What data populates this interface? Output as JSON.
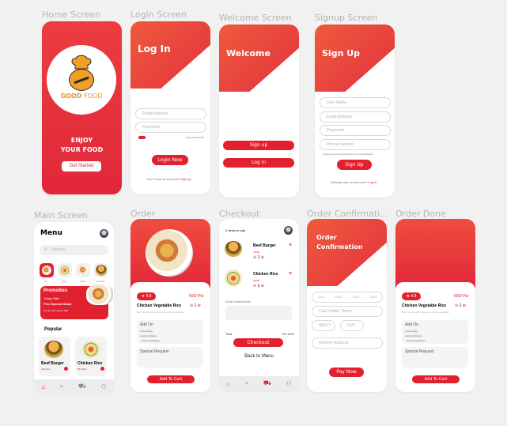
{
  "frame_titles": {
    "home": "Home Screen",
    "login": "Login Screen",
    "welcome": "Welcome Screen",
    "signup": "Signup Screen",
    "main": "Main Screen",
    "order": "Order",
    "checkout": "Checkout",
    "confirmation": "Order Confirmati...",
    "done": "Order Done"
  },
  "colors": {
    "accent": "#e2212f",
    "gradient_start": "#ef5a3c",
    "background": "#f1f1f1"
  },
  "home": {
    "logo_text_good": "GOOD",
    "logo_text_food": "FOOD",
    "tagline_1": "ENJOY",
    "tagline_2": "YOUR FOOD",
    "cta": "Get Started"
  },
  "login": {
    "title": "Log In",
    "email_placeholder": "Email Address",
    "password_placeholder": "Password",
    "forgot": "forgot Password?",
    "button": "Login Now",
    "footer": "Don't have an account?",
    "footer_link": "Sign up"
  },
  "welcome": {
    "title": "Welcome",
    "signup_button": "Sign up",
    "login_button": "Log in"
  },
  "signup": {
    "title": "Sign Up",
    "fields": [
      "User Name",
      "Email Address",
      "Password",
      "Phone Number"
    ],
    "terms": "I accept the terms and privacy of this application",
    "button": "Sign Up",
    "footer": "Already have an account?",
    "footer_link": "Log in"
  },
  "main": {
    "title": "Menu",
    "search_placeholder": "Search",
    "categories": [
      "All",
      "Rice",
      "Grills",
      "Dessert"
    ],
    "promo_title": "Promotion",
    "promo_line1": "Today Offer",
    "promo_line2": "Free Special Salad",
    "promo_line3": "On all order above 15$",
    "popular": "Popular",
    "items": [
      {
        "name": "Beef Burger",
        "price": "4$ Order"
      },
      {
        "name": "Chicken Rice",
        "price": "8$ Order"
      }
    ]
  },
  "order": {
    "rating": "4.8",
    "price": "699/ Pkr",
    "qty": "1",
    "name": "Chicken Vegetable Rice",
    "description": "Stir fried rice with chicken & fresh vegetables",
    "addon_title": "Add On",
    "addons": [
      "Fried Egg",
      "Extra Chicken",
      "Extra Vegetables"
    ],
    "special": "Special Request",
    "button": "Add To Cart"
  },
  "checkout": {
    "header": "2 Items in cart",
    "items": [
      {
        "name": "Beef Burger",
        "price": "400Rs",
        "qty": "1"
      },
      {
        "name": "Chicken Rice",
        "price": "800Rs",
        "qty": "1"
      }
    ],
    "instructions": "Order Instructions",
    "total_label": "Total",
    "total_value": "Rs 1200",
    "checkout_button": "Checkout",
    "back": "Back to Menu"
  },
  "confirmation": {
    "title_1": "Order",
    "title_2": "Confirmation",
    "card_groups": [
      "1234",
      "5678",
      "1234",
      "5678"
    ],
    "card_holder": "Card Holder Name",
    "expiry": "MM/YY",
    "cvv": "CVV",
    "delivery": "Delivery Address",
    "button": "Pay Now"
  },
  "done": {
    "rating": "4.8",
    "price": "699/ Pkr",
    "qty": "1",
    "name": "Chicken Vegetable Rice",
    "description": "Stir fried rice with chicken & fresh vegetables",
    "addon_title": "Add On",
    "addons": [
      "Fried Egg",
      "Extra Chicken",
      "Extra Vegetables"
    ],
    "special": "Special Request",
    "button": "Add To Cart"
  }
}
